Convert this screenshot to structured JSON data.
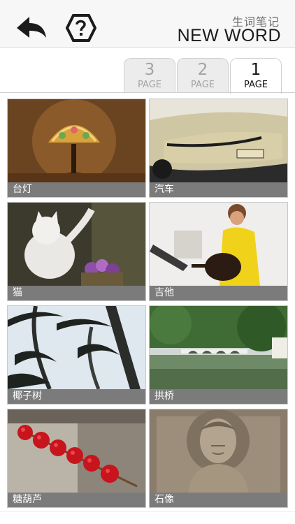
{
  "header": {
    "subtitle": "生词笔记",
    "title": "NEW WORD",
    "back_icon": "back-arrow-icon",
    "help_icon": "help-question-icon"
  },
  "tabs": [
    {
      "num": "3",
      "label": "PAGE",
      "active": false
    },
    {
      "num": "2",
      "label": "PAGE",
      "active": false
    },
    {
      "num": "1",
      "label": "PAGE",
      "active": true
    }
  ],
  "words": [
    {
      "caption": "台灯",
      "image": "table-lamp-photo"
    },
    {
      "caption": "汽车",
      "image": "car-photo"
    },
    {
      "caption": "猫",
      "image": "cat-photo"
    },
    {
      "caption": "吉他",
      "image": "guitar-photo"
    },
    {
      "caption": "椰子树",
      "image": "coconut-tree-photo"
    },
    {
      "caption": "拱桥",
      "image": "arch-bridge-photo"
    },
    {
      "caption": "糖葫芦",
      "image": "candied-haws-photo"
    },
    {
      "caption": "石像",
      "image": "stone-statue-photo"
    }
  ],
  "colors": {
    "header_bg": "#f7f7f7",
    "caption_bg": "#7b7b7b",
    "active_tab_text": "#111111",
    "inactive_tab_text": "#a3a3a3"
  }
}
